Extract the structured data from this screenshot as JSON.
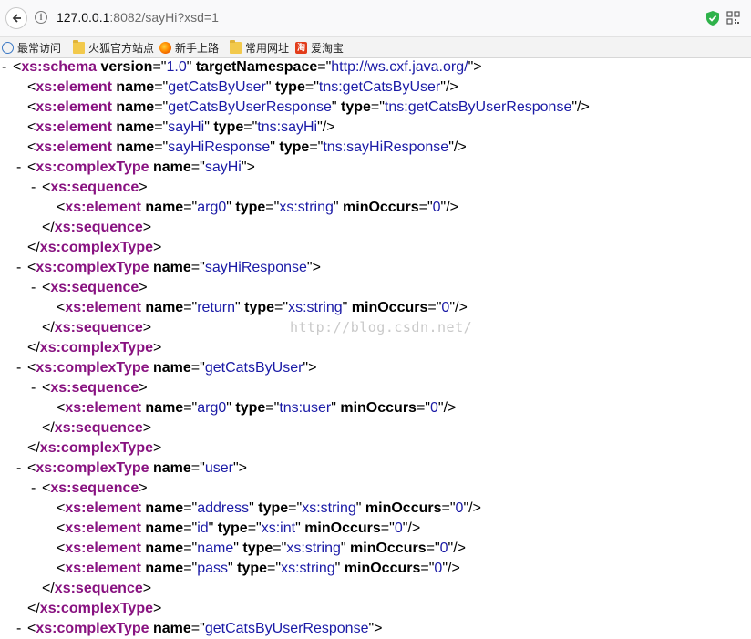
{
  "browser": {
    "url_host": "127.0.0.1",
    "url_rest": ":8082/sayHi?xsd=1",
    "bookmarks": [
      {
        "label": "最常访问",
        "icon": "globe-icon"
      },
      {
        "label": "火狐官方站点",
        "icon": "folder-icon"
      },
      {
        "label": "新手上路",
        "icon": "firefox-icon"
      },
      {
        "label": "常用网址",
        "icon": "folder-icon"
      },
      {
        "label": "爱淘宝",
        "icon": "taobao-icon",
        "icon_text": "淘"
      }
    ]
  },
  "xml_lines": [
    {
      "indent": 0,
      "collapse": "-",
      "parts": [
        {
          "k": "p",
          "t": "<"
        },
        {
          "k": "g",
          "t": "xs:schema"
        },
        {
          "k": "p",
          "t": " "
        },
        {
          "k": "a",
          "t": "version"
        },
        {
          "k": "p",
          "t": "=\""
        },
        {
          "k": "v",
          "t": "1.0"
        },
        {
          "k": "p",
          "t": "\" "
        },
        {
          "k": "a",
          "t": "targetNamespace"
        },
        {
          "k": "p",
          "t": "=\""
        },
        {
          "k": "v",
          "t": "http://ws.cxf.java.org/"
        },
        {
          "k": "p",
          "t": "\">"
        }
      ]
    },
    {
      "indent": 1,
      "collapse": "",
      "parts": [
        {
          "k": "p",
          "t": "<"
        },
        {
          "k": "g",
          "t": "xs:element"
        },
        {
          "k": "p",
          "t": " "
        },
        {
          "k": "a",
          "t": "name"
        },
        {
          "k": "p",
          "t": "=\""
        },
        {
          "k": "v",
          "t": "getCatsByUser"
        },
        {
          "k": "p",
          "t": "\" "
        },
        {
          "k": "a",
          "t": "type"
        },
        {
          "k": "p",
          "t": "=\""
        },
        {
          "k": "v",
          "t": "tns:getCatsByUser"
        },
        {
          "k": "p",
          "t": "\"/>"
        }
      ]
    },
    {
      "indent": 1,
      "collapse": "",
      "parts": [
        {
          "k": "p",
          "t": "<"
        },
        {
          "k": "g",
          "t": "xs:element"
        },
        {
          "k": "p",
          "t": " "
        },
        {
          "k": "a",
          "t": "name"
        },
        {
          "k": "p",
          "t": "=\""
        },
        {
          "k": "v",
          "t": "getCatsByUserResponse"
        },
        {
          "k": "p",
          "t": "\" "
        },
        {
          "k": "a",
          "t": "type"
        },
        {
          "k": "p",
          "t": "=\""
        },
        {
          "k": "v",
          "t": "tns:getCatsByUserResponse"
        },
        {
          "k": "p",
          "t": "\"/>"
        }
      ]
    },
    {
      "indent": 1,
      "collapse": "",
      "parts": [
        {
          "k": "p",
          "t": "<"
        },
        {
          "k": "g",
          "t": "xs:element"
        },
        {
          "k": "p",
          "t": " "
        },
        {
          "k": "a",
          "t": "name"
        },
        {
          "k": "p",
          "t": "=\""
        },
        {
          "k": "v",
          "t": "sayHi"
        },
        {
          "k": "p",
          "t": "\" "
        },
        {
          "k": "a",
          "t": "type"
        },
        {
          "k": "p",
          "t": "=\""
        },
        {
          "k": "v",
          "t": "tns:sayHi"
        },
        {
          "k": "p",
          "t": "\"/>"
        }
      ]
    },
    {
      "indent": 1,
      "collapse": "",
      "parts": [
        {
          "k": "p",
          "t": "<"
        },
        {
          "k": "g",
          "t": "xs:element"
        },
        {
          "k": "p",
          "t": " "
        },
        {
          "k": "a",
          "t": "name"
        },
        {
          "k": "p",
          "t": "=\""
        },
        {
          "k": "v",
          "t": "sayHiResponse"
        },
        {
          "k": "p",
          "t": "\" "
        },
        {
          "k": "a",
          "t": "type"
        },
        {
          "k": "p",
          "t": "=\""
        },
        {
          "k": "v",
          "t": "tns:sayHiResponse"
        },
        {
          "k": "p",
          "t": "\"/>"
        }
      ]
    },
    {
      "indent": 1,
      "collapse": "-",
      "parts": [
        {
          "k": "p",
          "t": "<"
        },
        {
          "k": "g",
          "t": "xs:complexType"
        },
        {
          "k": "p",
          "t": " "
        },
        {
          "k": "a",
          "t": "name"
        },
        {
          "k": "p",
          "t": "=\""
        },
        {
          "k": "v",
          "t": "sayHi"
        },
        {
          "k": "p",
          "t": "\">"
        }
      ]
    },
    {
      "indent": 2,
      "collapse": "-",
      "parts": [
        {
          "k": "p",
          "t": "<"
        },
        {
          "k": "g",
          "t": "xs:sequence"
        },
        {
          "k": "p",
          "t": ">"
        }
      ]
    },
    {
      "indent": 3,
      "collapse": "",
      "parts": [
        {
          "k": "p",
          "t": "<"
        },
        {
          "k": "g",
          "t": "xs:element"
        },
        {
          "k": "p",
          "t": " "
        },
        {
          "k": "a",
          "t": "name"
        },
        {
          "k": "p",
          "t": "=\""
        },
        {
          "k": "v",
          "t": "arg0"
        },
        {
          "k": "p",
          "t": "\" "
        },
        {
          "k": "a",
          "t": "type"
        },
        {
          "k": "p",
          "t": "=\""
        },
        {
          "k": "v",
          "t": "xs:string"
        },
        {
          "k": "p",
          "t": "\" "
        },
        {
          "k": "a",
          "t": "minOccurs"
        },
        {
          "k": "p",
          "t": "=\""
        },
        {
          "k": "v",
          "t": "0"
        },
        {
          "k": "p",
          "t": "\"/>"
        }
      ]
    },
    {
      "indent": 2,
      "collapse": "",
      "parts": [
        {
          "k": "p",
          "t": "</"
        },
        {
          "k": "g",
          "t": "xs:sequence"
        },
        {
          "k": "p",
          "t": ">"
        }
      ]
    },
    {
      "indent": 1,
      "collapse": "",
      "parts": [
        {
          "k": "p",
          "t": "</"
        },
        {
          "k": "g",
          "t": "xs:complexType"
        },
        {
          "k": "p",
          "t": ">"
        }
      ]
    },
    {
      "indent": 1,
      "collapse": "-",
      "parts": [
        {
          "k": "p",
          "t": "<"
        },
        {
          "k": "g",
          "t": "xs:complexType"
        },
        {
          "k": "p",
          "t": " "
        },
        {
          "k": "a",
          "t": "name"
        },
        {
          "k": "p",
          "t": "=\""
        },
        {
          "k": "v",
          "t": "sayHiResponse"
        },
        {
          "k": "p",
          "t": "\">"
        }
      ]
    },
    {
      "indent": 2,
      "collapse": "-",
      "parts": [
        {
          "k": "p",
          "t": "<"
        },
        {
          "k": "g",
          "t": "xs:sequence"
        },
        {
          "k": "p",
          "t": ">"
        }
      ]
    },
    {
      "indent": 3,
      "collapse": "",
      "parts": [
        {
          "k": "p",
          "t": "<"
        },
        {
          "k": "g",
          "t": "xs:element"
        },
        {
          "k": "p",
          "t": " "
        },
        {
          "k": "a",
          "t": "name"
        },
        {
          "k": "p",
          "t": "=\""
        },
        {
          "k": "v",
          "t": "return"
        },
        {
          "k": "p",
          "t": "\" "
        },
        {
          "k": "a",
          "t": "type"
        },
        {
          "k": "p",
          "t": "=\""
        },
        {
          "k": "v",
          "t": "xs:string"
        },
        {
          "k": "p",
          "t": "\" "
        },
        {
          "k": "a",
          "t": "minOccurs"
        },
        {
          "k": "p",
          "t": "=\""
        },
        {
          "k": "v",
          "t": "0"
        },
        {
          "k": "p",
          "t": "\"/>"
        }
      ]
    },
    {
      "indent": 2,
      "collapse": "",
      "parts": [
        {
          "k": "p",
          "t": "</"
        },
        {
          "k": "g",
          "t": "xs:sequence"
        },
        {
          "k": "p",
          "t": ">"
        }
      ]
    },
    {
      "indent": 1,
      "collapse": "",
      "parts": [
        {
          "k": "p",
          "t": "</"
        },
        {
          "k": "g",
          "t": "xs:complexType"
        },
        {
          "k": "p",
          "t": ">"
        }
      ]
    },
    {
      "indent": 1,
      "collapse": "-",
      "parts": [
        {
          "k": "p",
          "t": "<"
        },
        {
          "k": "g",
          "t": "xs:complexType"
        },
        {
          "k": "p",
          "t": " "
        },
        {
          "k": "a",
          "t": "name"
        },
        {
          "k": "p",
          "t": "=\""
        },
        {
          "k": "v",
          "t": "getCatsByUser"
        },
        {
          "k": "p",
          "t": "\">"
        }
      ]
    },
    {
      "indent": 2,
      "collapse": "-",
      "parts": [
        {
          "k": "p",
          "t": "<"
        },
        {
          "k": "g",
          "t": "xs:sequence"
        },
        {
          "k": "p",
          "t": ">"
        }
      ]
    },
    {
      "indent": 3,
      "collapse": "",
      "parts": [
        {
          "k": "p",
          "t": "<"
        },
        {
          "k": "g",
          "t": "xs:element"
        },
        {
          "k": "p",
          "t": " "
        },
        {
          "k": "a",
          "t": "name"
        },
        {
          "k": "p",
          "t": "=\""
        },
        {
          "k": "v",
          "t": "arg0"
        },
        {
          "k": "p",
          "t": "\" "
        },
        {
          "k": "a",
          "t": "type"
        },
        {
          "k": "p",
          "t": "=\""
        },
        {
          "k": "v",
          "t": "tns:user"
        },
        {
          "k": "p",
          "t": "\" "
        },
        {
          "k": "a",
          "t": "minOccurs"
        },
        {
          "k": "p",
          "t": "=\""
        },
        {
          "k": "v",
          "t": "0"
        },
        {
          "k": "p",
          "t": "\"/>"
        }
      ]
    },
    {
      "indent": 2,
      "collapse": "",
      "parts": [
        {
          "k": "p",
          "t": "</"
        },
        {
          "k": "g",
          "t": "xs:sequence"
        },
        {
          "k": "p",
          "t": ">"
        }
      ]
    },
    {
      "indent": 1,
      "collapse": "",
      "parts": [
        {
          "k": "p",
          "t": "</"
        },
        {
          "k": "g",
          "t": "xs:complexType"
        },
        {
          "k": "p",
          "t": ">"
        }
      ]
    },
    {
      "indent": 1,
      "collapse": "-",
      "parts": [
        {
          "k": "p",
          "t": "<"
        },
        {
          "k": "g",
          "t": "xs:complexType"
        },
        {
          "k": "p",
          "t": " "
        },
        {
          "k": "a",
          "t": "name"
        },
        {
          "k": "p",
          "t": "=\""
        },
        {
          "k": "v",
          "t": "user"
        },
        {
          "k": "p",
          "t": "\">"
        }
      ]
    },
    {
      "indent": 2,
      "collapse": "-",
      "parts": [
        {
          "k": "p",
          "t": "<"
        },
        {
          "k": "g",
          "t": "xs:sequence"
        },
        {
          "k": "p",
          "t": ">"
        }
      ]
    },
    {
      "indent": 3,
      "collapse": "",
      "parts": [
        {
          "k": "p",
          "t": "<"
        },
        {
          "k": "g",
          "t": "xs:element"
        },
        {
          "k": "p",
          "t": " "
        },
        {
          "k": "a",
          "t": "name"
        },
        {
          "k": "p",
          "t": "=\""
        },
        {
          "k": "v",
          "t": "address"
        },
        {
          "k": "p",
          "t": "\" "
        },
        {
          "k": "a",
          "t": "type"
        },
        {
          "k": "p",
          "t": "=\""
        },
        {
          "k": "v",
          "t": "xs:string"
        },
        {
          "k": "p",
          "t": "\" "
        },
        {
          "k": "a",
          "t": "minOccurs"
        },
        {
          "k": "p",
          "t": "=\""
        },
        {
          "k": "v",
          "t": "0"
        },
        {
          "k": "p",
          "t": "\"/>"
        }
      ]
    },
    {
      "indent": 3,
      "collapse": "",
      "parts": [
        {
          "k": "p",
          "t": "<"
        },
        {
          "k": "g",
          "t": "xs:element"
        },
        {
          "k": "p",
          "t": " "
        },
        {
          "k": "a",
          "t": "name"
        },
        {
          "k": "p",
          "t": "=\""
        },
        {
          "k": "v",
          "t": "id"
        },
        {
          "k": "p",
          "t": "\" "
        },
        {
          "k": "a",
          "t": "type"
        },
        {
          "k": "p",
          "t": "=\""
        },
        {
          "k": "v",
          "t": "xs:int"
        },
        {
          "k": "p",
          "t": "\" "
        },
        {
          "k": "a",
          "t": "minOccurs"
        },
        {
          "k": "p",
          "t": "=\""
        },
        {
          "k": "v",
          "t": "0"
        },
        {
          "k": "p",
          "t": "\"/>"
        }
      ]
    },
    {
      "indent": 3,
      "collapse": "",
      "parts": [
        {
          "k": "p",
          "t": "<"
        },
        {
          "k": "g",
          "t": "xs:element"
        },
        {
          "k": "p",
          "t": " "
        },
        {
          "k": "a",
          "t": "name"
        },
        {
          "k": "p",
          "t": "=\""
        },
        {
          "k": "v",
          "t": "name"
        },
        {
          "k": "p",
          "t": "\" "
        },
        {
          "k": "a",
          "t": "type"
        },
        {
          "k": "p",
          "t": "=\""
        },
        {
          "k": "v",
          "t": "xs:string"
        },
        {
          "k": "p",
          "t": "\" "
        },
        {
          "k": "a",
          "t": "minOccurs"
        },
        {
          "k": "p",
          "t": "=\""
        },
        {
          "k": "v",
          "t": "0"
        },
        {
          "k": "p",
          "t": "\"/>"
        }
      ]
    },
    {
      "indent": 3,
      "collapse": "",
      "parts": [
        {
          "k": "p",
          "t": "<"
        },
        {
          "k": "g",
          "t": "xs:element"
        },
        {
          "k": "p",
          "t": " "
        },
        {
          "k": "a",
          "t": "name"
        },
        {
          "k": "p",
          "t": "=\""
        },
        {
          "k": "v",
          "t": "pass"
        },
        {
          "k": "p",
          "t": "\" "
        },
        {
          "k": "a",
          "t": "type"
        },
        {
          "k": "p",
          "t": "=\""
        },
        {
          "k": "v",
          "t": "xs:string"
        },
        {
          "k": "p",
          "t": "\" "
        },
        {
          "k": "a",
          "t": "minOccurs"
        },
        {
          "k": "p",
          "t": "=\""
        },
        {
          "k": "v",
          "t": "0"
        },
        {
          "k": "p",
          "t": "\"/>"
        }
      ]
    },
    {
      "indent": 2,
      "collapse": "",
      "parts": [
        {
          "k": "p",
          "t": "</"
        },
        {
          "k": "g",
          "t": "xs:sequence"
        },
        {
          "k": "p",
          "t": ">"
        }
      ]
    },
    {
      "indent": 1,
      "collapse": "",
      "parts": [
        {
          "k": "p",
          "t": "</"
        },
        {
          "k": "g",
          "t": "xs:complexType"
        },
        {
          "k": "p",
          "t": ">"
        }
      ]
    },
    {
      "indent": 1,
      "collapse": "-",
      "parts": [
        {
          "k": "p",
          "t": "<"
        },
        {
          "k": "g",
          "t": "xs:complexType"
        },
        {
          "k": "p",
          "t": " "
        },
        {
          "k": "a",
          "t": "name"
        },
        {
          "k": "p",
          "t": "=\""
        },
        {
          "k": "v",
          "t": "getCatsByUserResponse"
        },
        {
          "k": "p",
          "t": "\">"
        }
      ]
    }
  ],
  "watermark": "http://blog.csdn.net/"
}
